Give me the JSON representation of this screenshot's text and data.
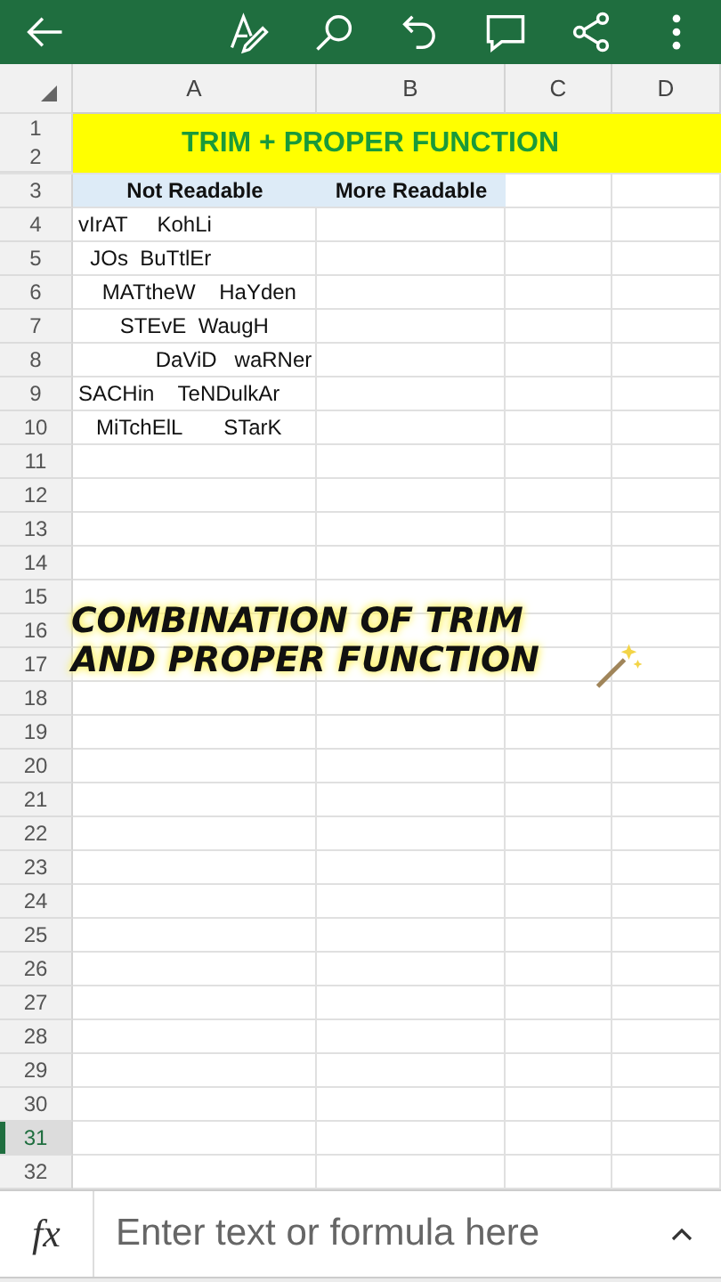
{
  "column_headers": [
    {
      "label": "A"
    },
    {
      "label": "B"
    },
    {
      "label": "C"
    },
    {
      "label": "D"
    }
  ],
  "banner": {
    "row_numbers": [
      "1",
      "2"
    ],
    "text": "TRIM + PROPER FUNCTION"
  },
  "rows": [
    {
      "number": "3",
      "selected": false,
      "kind": "heading",
      "cells": [
        "Not Readable",
        "More Readable"
      ]
    },
    {
      "number": "4",
      "selected": false,
      "kind": "data",
      "cells": [
        "vIrAT     KohLi"
      ]
    },
    {
      "number": "5",
      "selected": false,
      "kind": "data",
      "cells": [
        "  JOs  BuTtlEr"
      ]
    },
    {
      "number": "6",
      "selected": false,
      "kind": "data",
      "cells": [
        "    MATtheW    HaYden"
      ]
    },
    {
      "number": "7",
      "selected": false,
      "kind": "data",
      "cells": [
        "       STEvE  WaugH"
      ]
    },
    {
      "number": "8",
      "selected": false,
      "kind": "data",
      "cells": [
        "             DaViD   waRNer"
      ]
    },
    {
      "number": "9",
      "selected": false,
      "kind": "data",
      "cells": [
        "SACHin    TeNDulkAr"
      ]
    },
    {
      "number": "10",
      "selected": false,
      "kind": "data",
      "cells": [
        "   MiTchElL       STarK"
      ]
    },
    {
      "number": "11",
      "selected": false,
      "kind": "data"
    },
    {
      "number": "12",
      "selected": false,
      "kind": "data"
    },
    {
      "number": "13",
      "selected": false,
      "kind": "data"
    },
    {
      "number": "14",
      "selected": false,
      "kind": "data"
    },
    {
      "number": "15",
      "selected": false,
      "kind": "data"
    },
    {
      "number": "16",
      "selected": false,
      "kind": "data"
    },
    {
      "number": "17",
      "selected": false,
      "kind": "data"
    },
    {
      "number": "18",
      "selected": false,
      "kind": "data"
    },
    {
      "number": "19",
      "selected": false,
      "kind": "data"
    },
    {
      "number": "20",
      "selected": false,
      "kind": "data"
    },
    {
      "number": "21",
      "selected": false,
      "kind": "data"
    },
    {
      "number": "22",
      "selected": false,
      "kind": "data"
    },
    {
      "number": "23",
      "selected": false,
      "kind": "data"
    },
    {
      "number": "24",
      "selected": false,
      "kind": "data"
    },
    {
      "number": "25",
      "selected": false,
      "kind": "data"
    },
    {
      "number": "26",
      "selected": false,
      "kind": "data"
    },
    {
      "number": "27",
      "selected": false,
      "kind": "data"
    },
    {
      "number": "28",
      "selected": false,
      "kind": "data"
    },
    {
      "number": "29",
      "selected": false,
      "kind": "data"
    },
    {
      "number": "30",
      "selected": false,
      "kind": "data"
    },
    {
      "number": "31",
      "selected": true,
      "kind": "data"
    },
    {
      "number": "32",
      "selected": false,
      "kind": "data"
    }
  ],
  "caption": {
    "lines": [
      "COMBINATION OF TRIM",
      "AND PROPER FUNCTION"
    ]
  },
  "formula_bar": {
    "function_label": "fx",
    "placeholder": "Enter text or formula here"
  }
}
